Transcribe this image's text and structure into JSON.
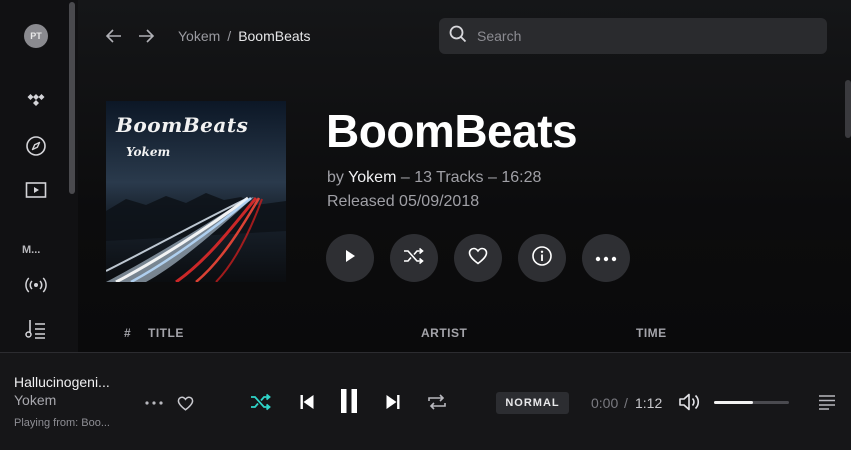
{
  "user": {
    "initials": "PT"
  },
  "sidebar": {
    "section_label": "M...",
    "items": [
      {
        "icon": "tidal-logo-icon"
      },
      {
        "icon": "compass-icon"
      },
      {
        "icon": "video-icon"
      },
      {
        "icon": "radio-icon"
      },
      {
        "icon": "playlist-icon"
      }
    ]
  },
  "breadcrumb": {
    "parent": "Yokem",
    "separator": "/",
    "current": "BoomBeats"
  },
  "search": {
    "placeholder": "Search",
    "value": ""
  },
  "album": {
    "title": "BoomBeats",
    "by_label": "by",
    "artist": "Yokem",
    "details": "– 13 Tracks – 16:28",
    "released": "Released 05/09/2018",
    "cover_title": "BoomBeats",
    "cover_artist": "Yokem"
  },
  "actions": [
    "play-button",
    "shuffle-button",
    "favorite-button",
    "info-button",
    "more-button"
  ],
  "track_table": {
    "columns": {
      "number": "#",
      "title": "TITLE",
      "artist": "ARTIST",
      "time": "TIME"
    }
  },
  "player": {
    "track_title": "Hallucinogeni...",
    "track_artist": "Yokem",
    "source": "Playing from:  Boo...",
    "quality": "NORMAL",
    "time_current": "0:00",
    "time_separator": "/",
    "time_total": "1:12",
    "volume_percent": 52
  },
  "colors": {
    "accent_teal": "#2fd4c8",
    "background": "#000000",
    "button_bg": "#2e2f33"
  }
}
